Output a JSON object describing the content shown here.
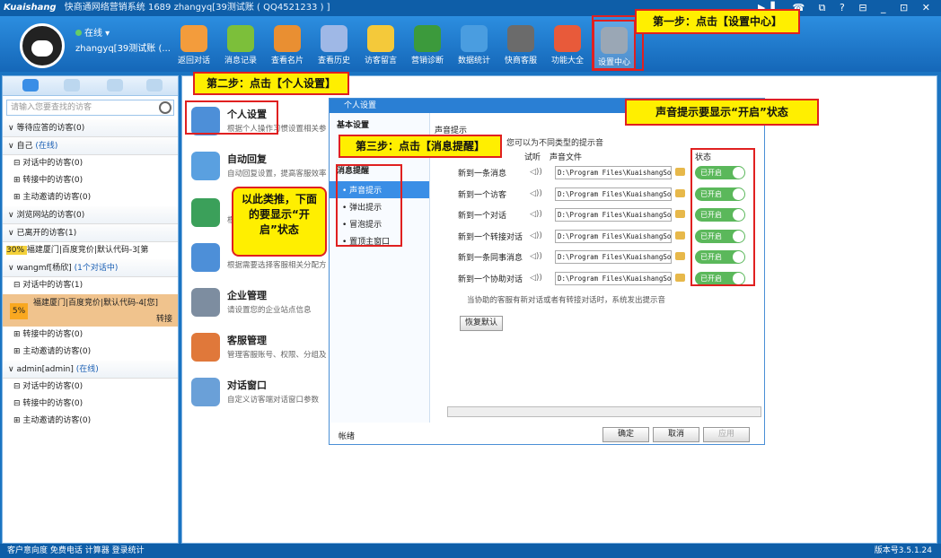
{
  "titlebar": {
    "logo": "Kuaishang",
    "title": "快商通网络营销系统 1689 zhangyq[39测试账 ( QQ4521233 ) ]",
    "controls": "▶▌ ☎ ⧉ ? ⊟ _ ⊡ ✕"
  },
  "user": {
    "status": "在线",
    "name": "zhangyq[39测试账 (..."
  },
  "toolbar": [
    {
      "label": "返回对话",
      "icon": "back-arrow-icon",
      "color": "#f39c3c"
    },
    {
      "label": "消息记录",
      "icon": "message-record-icon",
      "color": "#7cbf3a"
    },
    {
      "label": "查看名片",
      "icon": "business-card-icon",
      "color": "#e98f32"
    },
    {
      "label": "查看历史",
      "icon": "history-icon",
      "color": "#9fb8e6"
    },
    {
      "label": "访客留言",
      "icon": "visitor-message-icon",
      "color": "#f4c93a"
    },
    {
      "label": "营销诊断",
      "icon": "marketing-diagnosis-icon",
      "color": "#3c9a3c"
    },
    {
      "label": "数据统计",
      "icon": "statistics-icon",
      "color": "#4a9de0"
    },
    {
      "label": "快商客服",
      "icon": "customer-service-icon",
      "color": "#6b6b6b"
    },
    {
      "label": "功能大全",
      "icon": "features-icon",
      "color": "#e85a3a"
    },
    {
      "label": "设置中心",
      "icon": "settings-gear-icon",
      "color": "#9aa7b5"
    }
  ],
  "left": {
    "search_placeholder": "请输入您要查找的访客",
    "groups": [
      {
        "label": "等待应答的访客(0)"
      },
      {
        "label": "自己",
        "status": "(在线)",
        "subs": [
          "⊟ 对话中的访客(0)",
          "⊞ 转接中的访客(0)",
          "⊞ 主动邀请的访客(0)"
        ]
      },
      {
        "label": "浏览网站的访客(0)"
      },
      {
        "label": "已离开的访客(1)",
        "item": "福建厦门|百度竞价|默认代码-3[第",
        "badge": "30%"
      },
      {
        "label": "wangmf[杨欣]",
        "status": "(1个对话中)",
        "subs": [
          "⊟ 对话中的访客(1)"
        ],
        "highlight": "福建厦门|百度竞价|默认代码-4[您]",
        "hl_badge": "5%",
        "hl_action": "转接",
        "subs2": [
          "⊞ 转接中的访客(0)",
          "⊞ 主动邀请的访客(0)"
        ]
      },
      {
        "label": "admin[admin]",
        "status": "(在线)",
        "subs": [
          "⊟ 对话中的访客(0)",
          "⊟ 转接中的访客(0)",
          "⊞ 主动邀请的访客(0)"
        ]
      }
    ]
  },
  "menu": [
    {
      "title": "个人设置",
      "desc": "根据个人操作习惯设置相关参"
    },
    {
      "title": "自动回复",
      "desc": "自动回复设置，提高客服效率"
    },
    {
      "title": "",
      "desc": "根"
    },
    {
      "title": "",
      "desc": "根据需要选择客服相关分配方"
    },
    {
      "title": "企业管理",
      "desc": "请设置您的企业站点信息"
    },
    {
      "title": "客服管理",
      "desc": "管理客服账号、权限、分组及"
    },
    {
      "title": "对话窗口",
      "desc": "自定义访客端对话窗口参数"
    }
  ],
  "dialog": {
    "title": "个人设置",
    "sec_basic": "基本设置",
    "sec_msg": "消息提醒",
    "options": [
      "声音提示",
      "弹出提示",
      "冒泡提示",
      "置顶主窗口"
    ],
    "section_title": "声音提示",
    "hint": "您可以为不同类型的提示音",
    "col_listen": "试听",
    "col_file": "声音文件",
    "col_status": "状态",
    "rows": [
      {
        "label": "新到一条消息",
        "path": "D:\\Program Files\\KuaishangSof",
        "state": "已开启"
      },
      {
        "label": "新到一个访客",
        "path": "D:\\Program Files\\KuaishangSof",
        "state": "已开启"
      },
      {
        "label": "新到一个对话",
        "path": "D:\\Program Files\\KuaishangSof",
        "state": "已开启"
      },
      {
        "label": "新到一个转接对话",
        "path": "D:\\Program Files\\KuaishangSof",
        "state": "已开启"
      },
      {
        "label": "新到一条同事消息",
        "path": "D:\\Program Files\\KuaishangSof",
        "state": "已开启"
      },
      {
        "label": "新到一个协助对话",
        "path": "D:\\Program Files\\KuaishangSof",
        "state": "已开启"
      }
    ],
    "note": "当协助的客服有新对话或者有转接对话时，系统发出提示音",
    "restore": "恢复默认",
    "footer_left": "帐绪",
    "ok": "确定",
    "cancel": "取消",
    "apply": "应用"
  },
  "callouts": {
    "step1": "第一步：点击【设置中心】",
    "step2": "第二步：点击【个人设置】",
    "step3": "第三步：点击【消息提醒】",
    "sound": "声音提示要显示“开启”状态",
    "similar": "以此类推，下面的要显示“开启”状态"
  },
  "statusbar": {
    "items": "客户意向度 免费电话 计算器 登录统计",
    "version": "版本号3.5.1.24"
  }
}
